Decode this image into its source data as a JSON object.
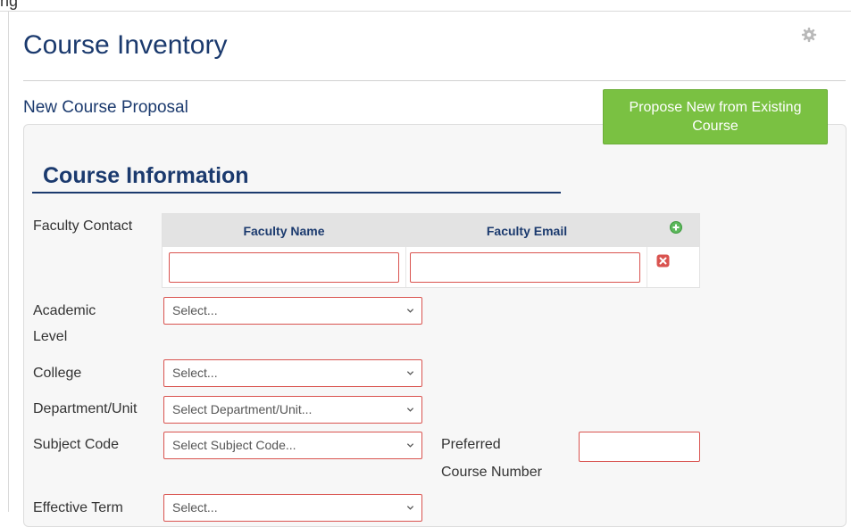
{
  "page": {
    "crop_title": "ng",
    "title": "Course Inventory",
    "subtitle": "New Course Proposal",
    "propose_button": "Propose New from Existing Course"
  },
  "section": {
    "heading": "Course Information"
  },
  "faculty": {
    "label": "Faculty Contact",
    "col_name": "Faculty Name",
    "col_email": "Faculty Email",
    "name_value": "",
    "email_value": ""
  },
  "fields": {
    "academic_level": {
      "label_line1": "Academic",
      "label_line2": "Level",
      "value": "Select..."
    },
    "college": {
      "label": "College",
      "value": "Select..."
    },
    "department": {
      "label": "Department/Unit",
      "value": "Select Department/Unit..."
    },
    "subject_code": {
      "label": "Subject Code",
      "value": "Select Subject Code..."
    },
    "preferred_number": {
      "label_line1": "Preferred",
      "label_line2": "Course Number",
      "value": ""
    },
    "effective_term": {
      "label": "Effective Term",
      "value": "Select..."
    }
  },
  "colors": {
    "title": "#1b3a6e",
    "accent_button": "#7ac142",
    "error_border": "#d9534f",
    "add_icon": "#5cb85c",
    "remove_icon": "#d9534f"
  },
  "icons": {
    "gear": "gear-icon",
    "add": "add-circle-icon",
    "remove": "remove-x-icon",
    "chevron": "chevron-down-icon"
  }
}
